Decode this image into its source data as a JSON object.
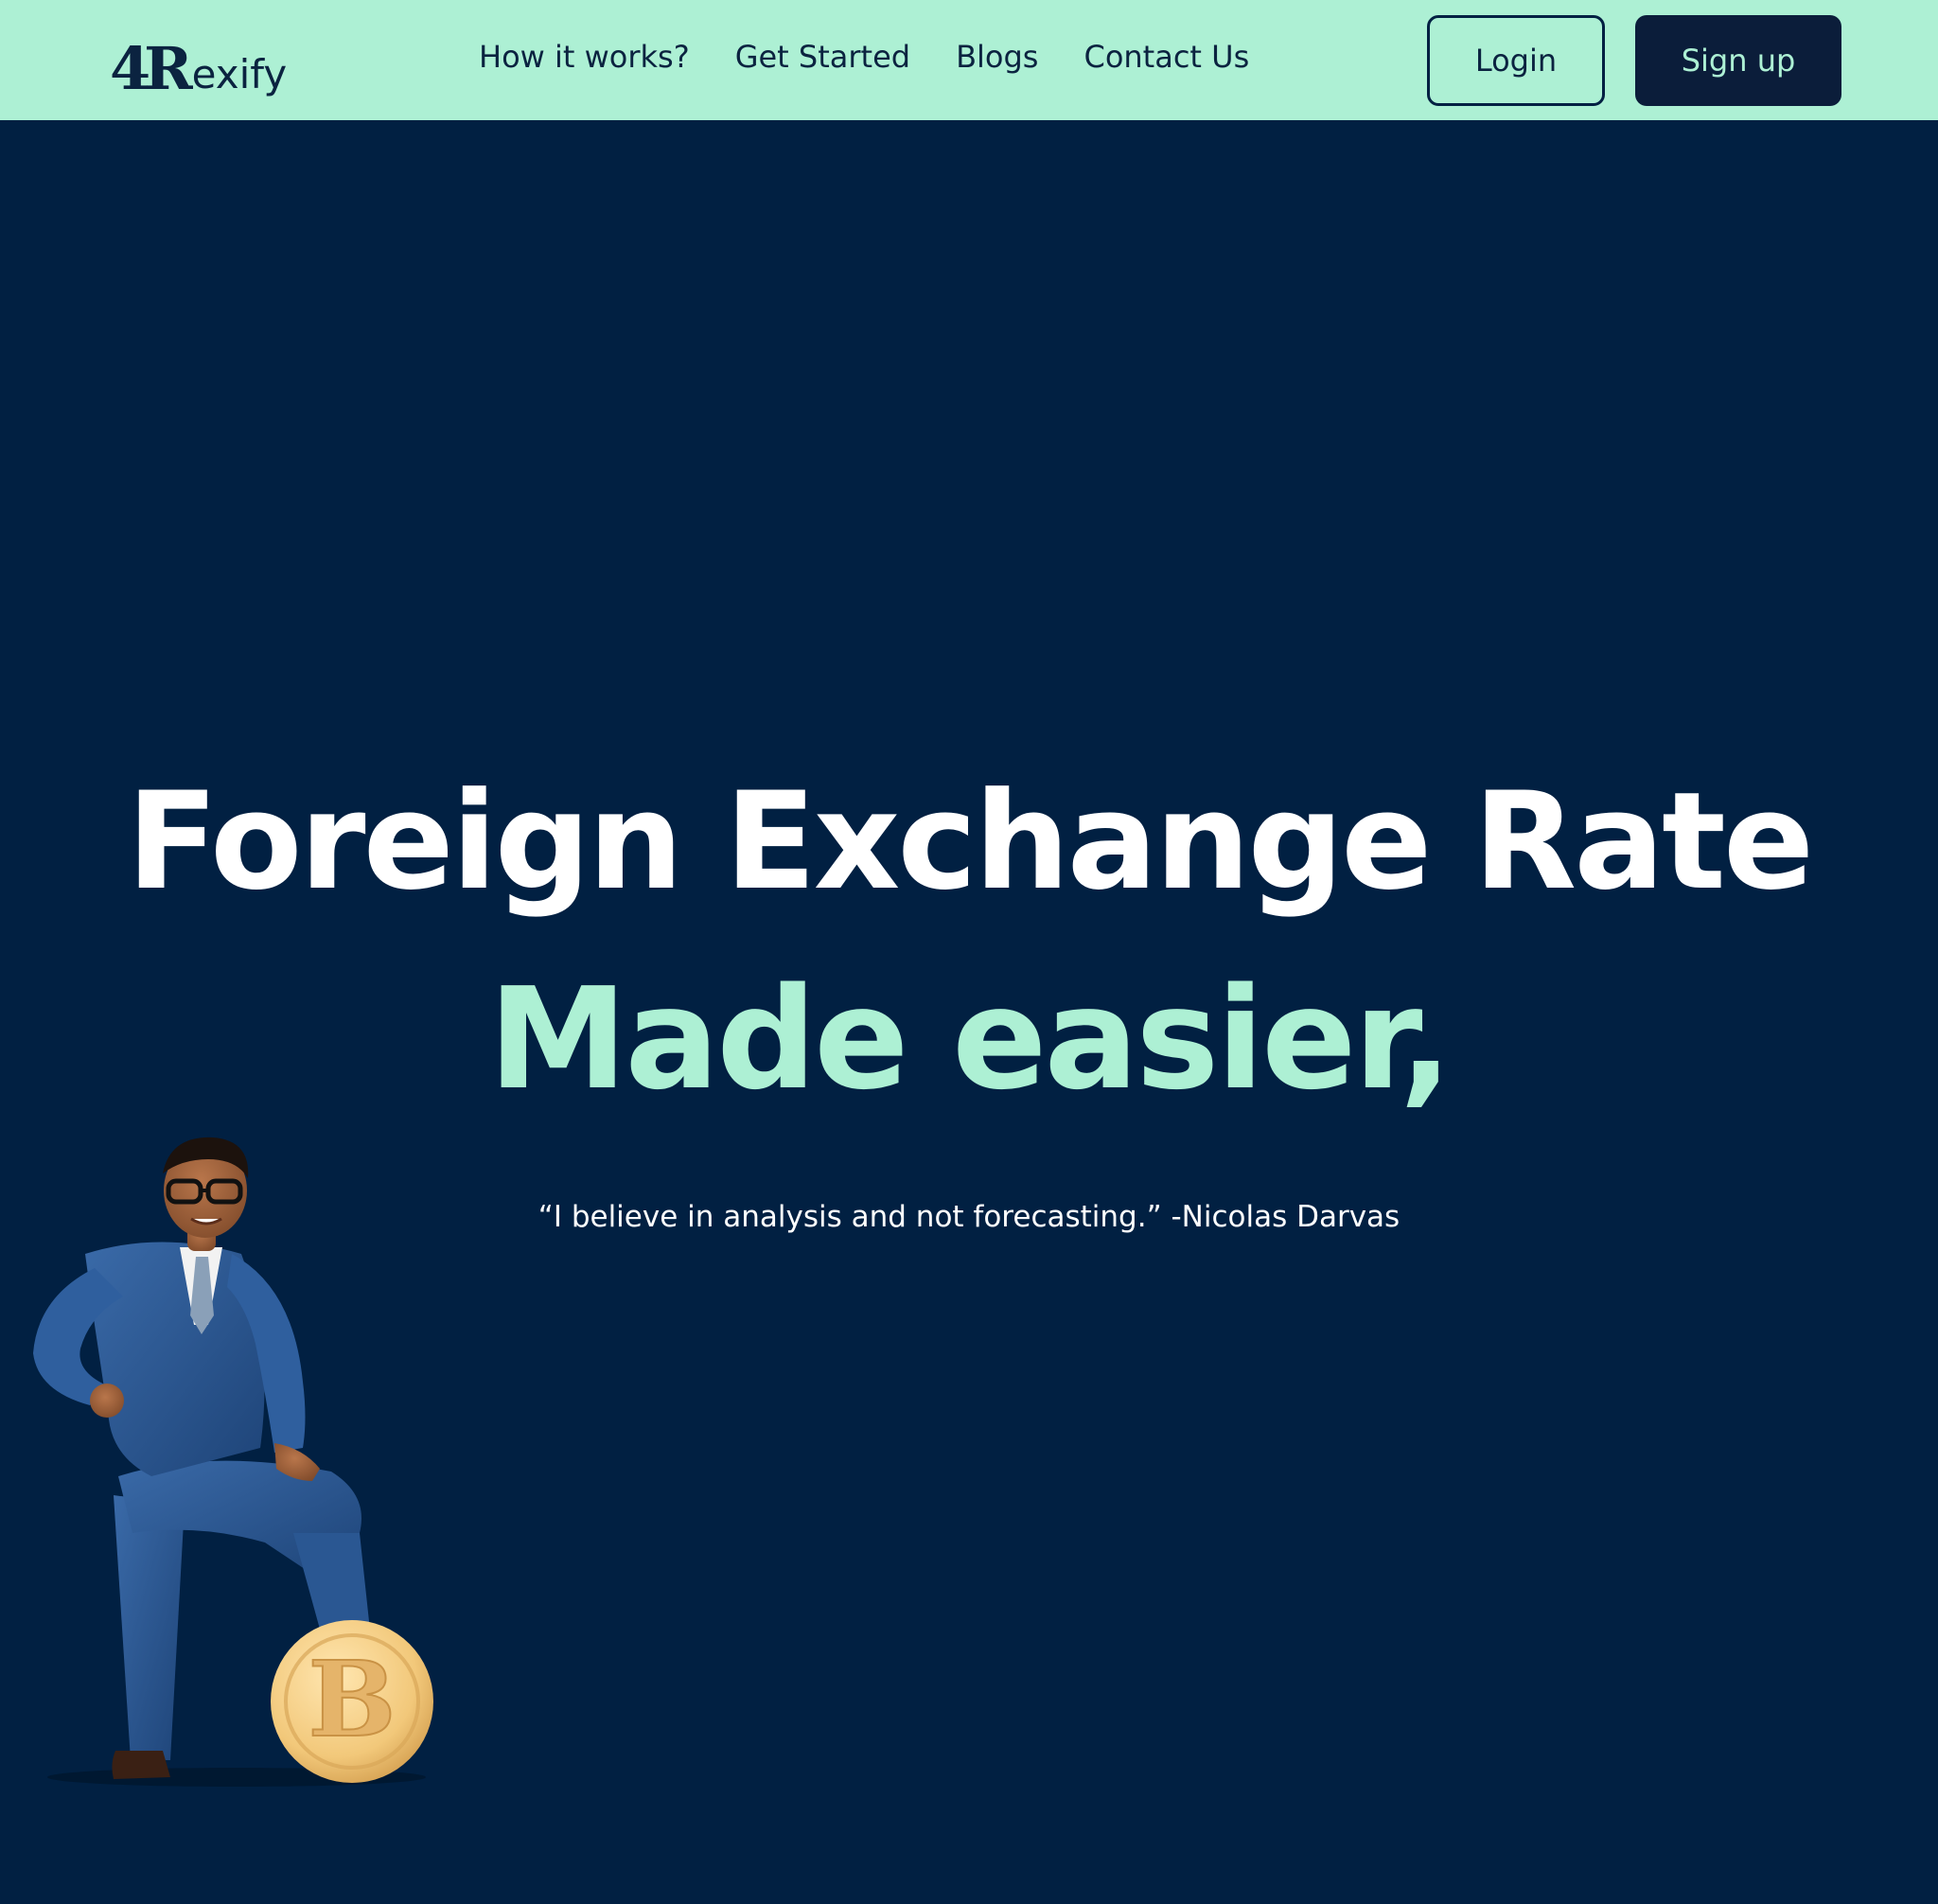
{
  "brand": {
    "logo_mark": "4R",
    "logo_text": "exify"
  },
  "nav": {
    "items": [
      {
        "label": "How it works?"
      },
      {
        "label": "Get Started"
      },
      {
        "label": "Blogs"
      },
      {
        "label": "Contact Us"
      }
    ],
    "login_label": "Login",
    "signup_label": "Sign up"
  },
  "hero": {
    "headline": "Foreign Exchange Rate",
    "subheadline": "Made easier,",
    "quote": "“I believe in analysis and not forecasting.” -Nicolas Darvas"
  },
  "illustration": {
    "icon": "businessman-on-bitcoin-icon",
    "coin_symbol": "B"
  },
  "colors": {
    "navbar_bg": "#adf0d4",
    "page_bg": "#012042",
    "accent": "#adf0d4",
    "headline": "#ffffff",
    "dark_button": "#0b1d3a"
  }
}
